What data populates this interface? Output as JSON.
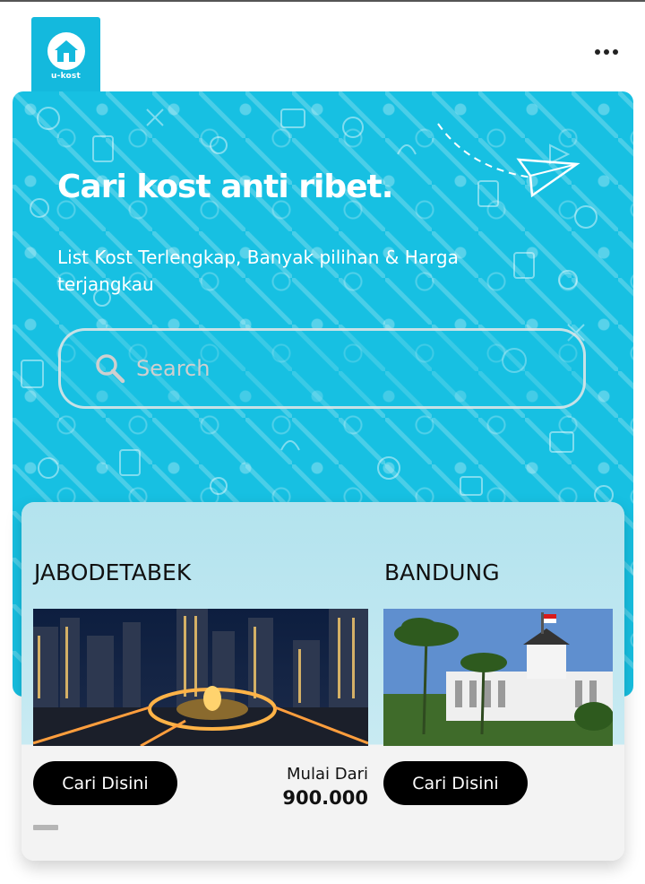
{
  "header": {
    "logo_text": "u-kost",
    "logo_icon": "house-icon",
    "menu_icon": "more-horizontal-icon"
  },
  "hero": {
    "title": "Cari kost anti ribet.",
    "subtitle": "List Kost Terlengkap, Banyak pilihan & Harga terjangkau",
    "search": {
      "placeholder": "Search",
      "icon": "search-icon"
    }
  },
  "cities": [
    {
      "name": "JABODETABEK",
      "button_label": "Cari Disini",
      "price_label": "Mulai Dari",
      "price_value": "900.000",
      "image": "jakarta-night-roundabout-photo"
    },
    {
      "name": "BANDUNG",
      "button_label": "Cari Disini",
      "image": "gedung-sate-photo"
    }
  ],
  "colors": {
    "accent": "#17c0e2",
    "button": "#000000",
    "panel": "#b3e3ee"
  }
}
